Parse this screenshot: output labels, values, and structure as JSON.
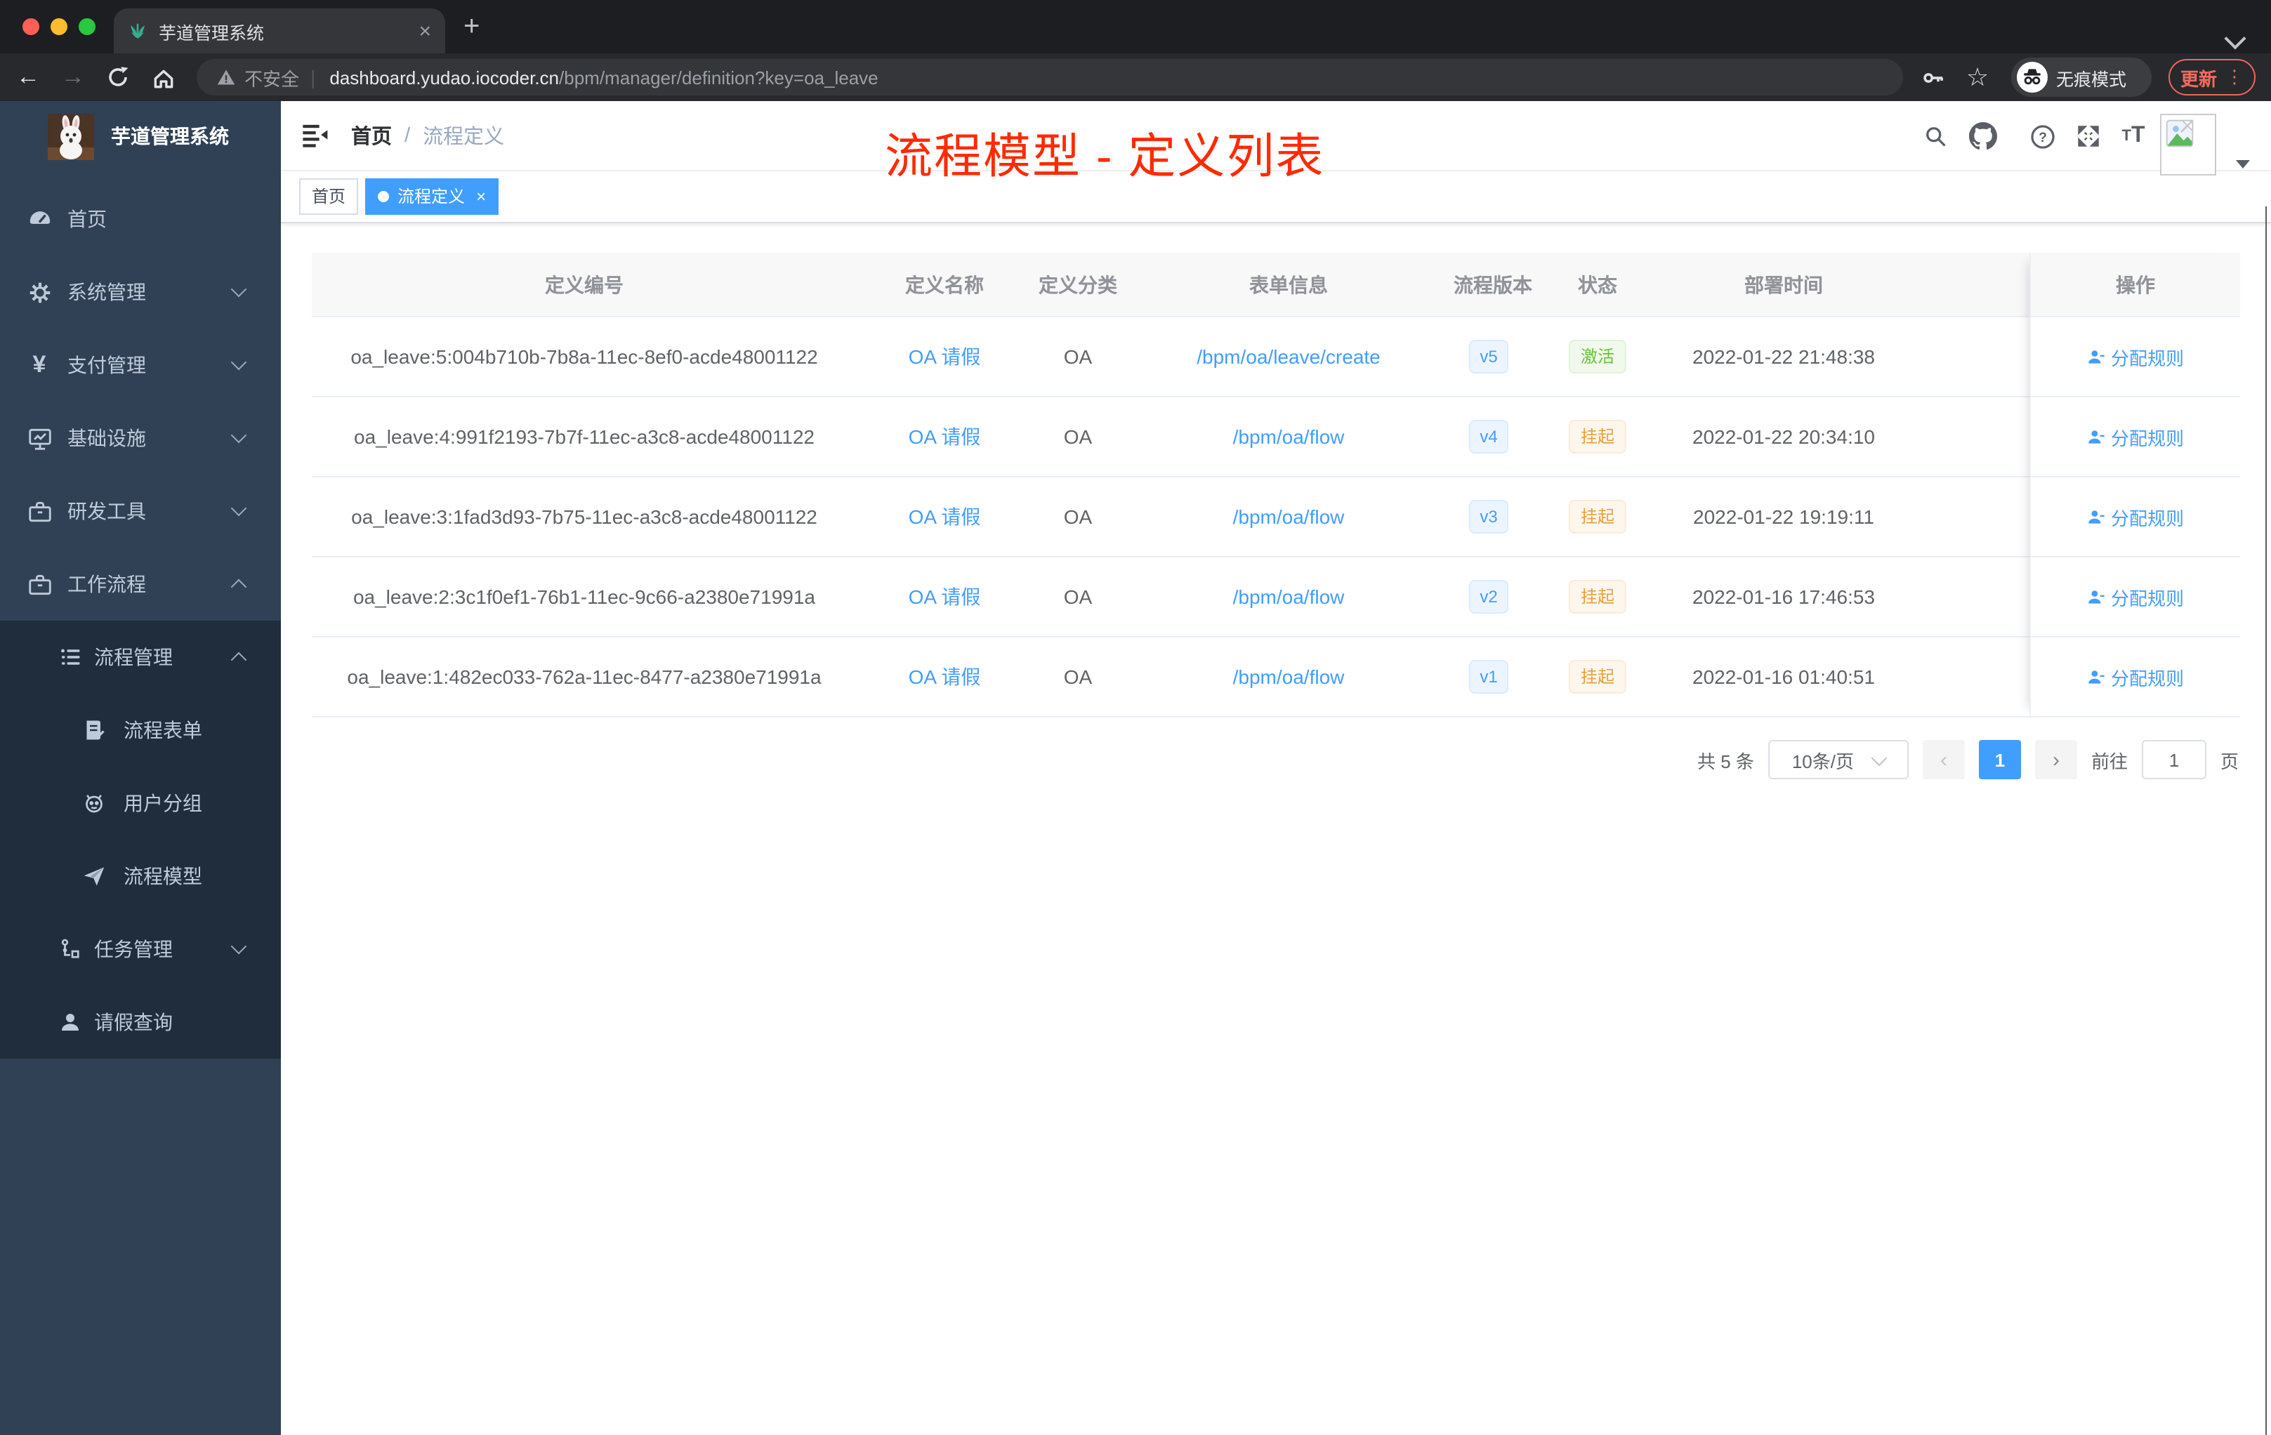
{
  "browser": {
    "tab": {
      "title": "芋道管理系统",
      "close": "×",
      "new_tab": "+"
    },
    "toolbar": {
      "security_warning": "不安全",
      "url_host": "dashboard.yudao.iocoder.cn",
      "url_path": "/bpm/manager/definition?key=oa_leave",
      "incognito_label": "无痕模式",
      "update_label": "更新",
      "kebab": "⋮"
    }
  },
  "sidebar": {
    "logo_title": "芋道管理系统",
    "menu": [
      {
        "label": "首页"
      },
      {
        "label": "系统管理"
      },
      {
        "label": "支付管理"
      },
      {
        "label": "基础设施"
      },
      {
        "label": "研发工具"
      },
      {
        "label": "工作流程"
      },
      {
        "label": "流程管理"
      },
      {
        "label": "流程表单"
      },
      {
        "label": "用户分组"
      },
      {
        "label": "流程模型"
      },
      {
        "label": "任务管理"
      },
      {
        "label": "请假查询"
      }
    ]
  },
  "navbar": {
    "breadcrumb": [
      "首页",
      "流程定义"
    ],
    "separator": "/"
  },
  "annotation": {
    "text": "流程模型 - 定义列表",
    "color": "#ff2a00"
  },
  "tags": [
    {
      "label": "首页",
      "active": false
    },
    {
      "label": "流程定义",
      "active": true,
      "close": "×"
    }
  ],
  "table": {
    "columns": [
      "定义编号",
      "定义名称",
      "定义分类",
      "表单信息",
      "流程版本",
      "状态",
      "部署时间",
      "操作"
    ],
    "action_label": "分配规则",
    "rows": [
      {
        "id": "oa_leave:5:004b710b-7b8a-11ec-8ef0-acde48001122",
        "name": "OA 请假",
        "category": "OA",
        "form": "/bpm/oa/leave/create",
        "version": "v5",
        "status": "激活",
        "time": "2022-01-22 21:48:38"
      },
      {
        "id": "oa_leave:4:991f2193-7b7f-11ec-a3c8-acde48001122",
        "name": "OA 请假",
        "category": "OA",
        "form": "/bpm/oa/flow",
        "version": "v4",
        "status": "挂起",
        "time": "2022-01-22 20:34:10"
      },
      {
        "id": "oa_leave:3:1fad3d93-7b75-11ec-a3c8-acde48001122",
        "name": "OA 请假",
        "category": "OA",
        "form": "/bpm/oa/flow",
        "version": "v3",
        "status": "挂起",
        "time": "2022-01-22 19:19:11"
      },
      {
        "id": "oa_leave:2:3c1f0ef1-76b1-11ec-9c66-a2380e71991a",
        "name": "OA 请假",
        "category": "OA",
        "form": "/bpm/oa/flow",
        "version": "v2",
        "status": "挂起",
        "time": "2022-01-16 17:46:53"
      },
      {
        "id": "oa_leave:1:482ec033-762a-11ec-8477-a2380e71991a",
        "name": "OA 请假",
        "category": "OA",
        "form": "/bpm/oa/flow",
        "version": "v1",
        "status": "挂起",
        "time": "2022-01-16 01:40:51"
      }
    ]
  },
  "pagination": {
    "total": "共 5 条",
    "page_size": "10条/页",
    "prev": "‹",
    "current": "1",
    "next": "›",
    "goto_label": "前往",
    "goto_value": "1",
    "unit": "页"
  },
  "colors": {
    "accent": "#409eff",
    "success": "#67c23a",
    "warning": "#e6a23c",
    "annotation": "#ff2a00",
    "sidebar": "#304156",
    "sidebar_submenu": "#1f2d3d"
  }
}
